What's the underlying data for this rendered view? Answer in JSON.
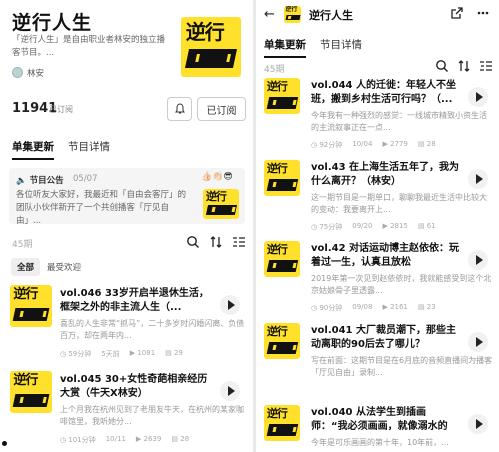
{
  "left": {
    "title": "逆行人生",
    "description": "「逆行人生」是自由职业者林安的独立播客节目。...",
    "host": "林安",
    "subscribers": "11941",
    "subscribers_label": "已订阅",
    "subscribe_button": "已订阅",
    "tabs": [
      "单集更新",
      "节目详情"
    ],
    "notice": {
      "title": "节目公告",
      "date": "05/07",
      "body": "各位听友大家好，我最近和「自由会客厅」的团队小伙伴新开了一个共创播客「厅见自由」...",
      "emoji": "👍🏻👏🏻😎"
    },
    "episode_count": "45期",
    "filters": [
      "全部",
      "最受欢迎"
    ],
    "episodes": [
      {
        "title": "vol.046 33岁开启半退休生活，框架之外的非主流人生（...",
        "summary": "喜乱的人生非常“抓马”，二十多岁时闪婚闪离、负债百万，却在两年内...",
        "duration": "59分钟",
        "time": "5天前",
        "plays": "1081",
        "comments": "29"
      },
      {
        "title": "vol.045 30+女性奇葩相亲经历大赏（牛天X林安）",
        "summary": "上个月我在杭州见到了老朋友牛天，在杭州的某家咖啡馆里，我听她分...",
        "duration": "101分钟",
        "time": "10/11",
        "plays": "2639",
        "comments": "28"
      }
    ]
  },
  "right": {
    "title": "逆行人生",
    "tabs": [
      "单集更新",
      "节目详情"
    ],
    "episode_count": "45期",
    "episodes": [
      {
        "title": "vol.044 人的迁徙：年轻人不坐班，搬到乡村生活可行吗？（...",
        "summary": "今年我有一种强烈的感觉：一线城市精致小资生活的主流叙事正在一点...",
        "duration": "92分钟",
        "time": "10/04",
        "plays": "2779",
        "comments": "28"
      },
      {
        "title": "vol.43 在上海生活五年了，我为什么离开？（林安）",
        "summary": "这一期节目是一期单口，聊聊我最近生活中比较大的变动：我要离开上...",
        "duration": "75分钟",
        "time": "09/20",
        "plays": "2815",
        "comments": "61"
      },
      {
        "title": "vol.42 对话运动博主赵依依：玩着过一生，认真且放松",
        "summary": "2019年第一次见到赵依依时，我就能感受到这个北京姑娘骨子里透露...",
        "duration": "90分钟",
        "time": "09/08",
        "plays": "2161",
        "comments": "23"
      },
      {
        "title": "vol.041 大厂裁员潮下，那些主动离职的90后去了哪儿？",
        "summary": "写在前面：这期节目是在6月底的音频直播间为播客「厅见自由」录制...",
        "duration": "",
        "time": "",
        "plays": "",
        "comments": ""
      },
      {
        "title": "vol.040 从法学生到插画师：“我必须画画，就像溺水的人...",
        "summary": "今年是可乐画画的第十年，10年前，...",
        "duration": "",
        "time": "",
        "plays": "",
        "comments": ""
      }
    ]
  },
  "colors": {
    "cover_yellow": "#ffe02b",
    "accent_dark": "#111111"
  }
}
